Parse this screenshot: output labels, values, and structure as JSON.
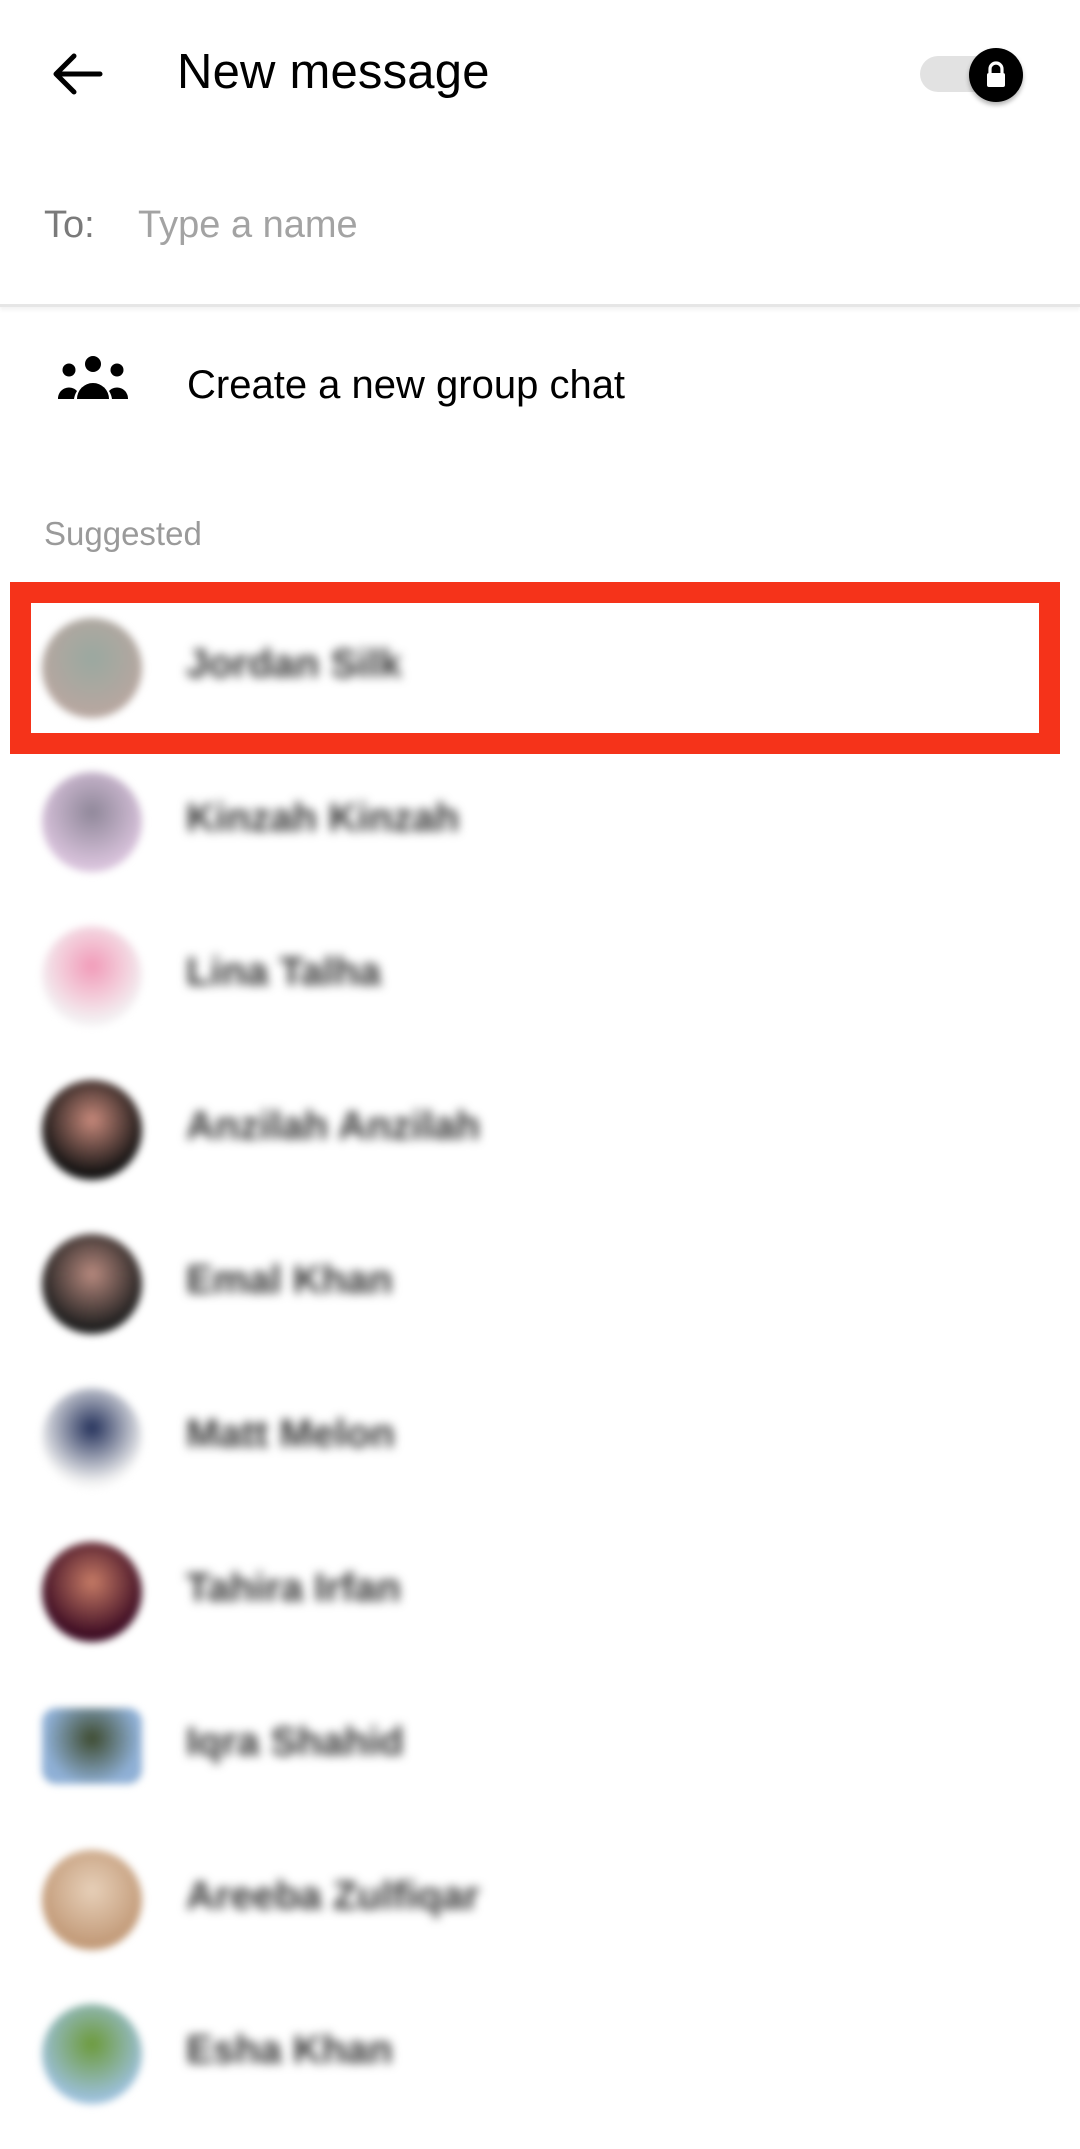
{
  "header": {
    "title": "New message",
    "back_icon": "arrow-left-icon",
    "secret_toggle": {
      "icon": "lock-icon",
      "state": "on"
    }
  },
  "to_field": {
    "label": "To:",
    "value": "",
    "placeholder": "Type a name"
  },
  "group_chat": {
    "icon": "group-icon",
    "label": "Create a new group chat"
  },
  "suggested": {
    "label": "Suggested",
    "contacts": [
      {
        "name": "Jordan Silk",
        "avatar_colors": [
          "#b7a7a0",
          "#9aa8a0"
        ],
        "highlighted": true
      },
      {
        "name": "Kinzah Kinzah",
        "avatar_colors": [
          "#d9c3dc",
          "#8f8799"
        ],
        "highlighted": false
      },
      {
        "name": "Lina Talha",
        "avatar_colors": [
          "#f3f0f2",
          "#f29ab8"
        ],
        "highlighted": false
      },
      {
        "name": "Anzilah Anzilah",
        "avatar_colors": [
          "#111111",
          "#c98a7c"
        ],
        "highlighted": false
      },
      {
        "name": "Emal Khan",
        "avatar_colors": [
          "#1e1e1e",
          "#b88a7f"
        ],
        "highlighted": false
      },
      {
        "name": "Matt Melon",
        "avatar_colors": [
          "#f4f4f4",
          "#23305a"
        ],
        "highlighted": false
      },
      {
        "name": "Tahira Irfan",
        "avatar_colors": [
          "#3b0a22",
          "#c77c66"
        ],
        "highlighted": false
      },
      {
        "name": "Iqra Shahid",
        "avatar_colors": [
          "#8fb0d6",
          "#3d4a2e"
        ],
        "highlighted": false
      },
      {
        "name": "Areeba Zulfiqar",
        "avatar_colors": [
          "#c29a78",
          "#e7d0b9"
        ],
        "highlighted": false
      },
      {
        "name": "Esha Khan",
        "avatar_colors": [
          "#9cc0da",
          "#6c9a3a"
        ],
        "highlighted": false
      }
    ]
  },
  "colors": {
    "highlight_border": "#f5331a",
    "toggle_track": "#e2e2e2",
    "toggle_knob": "#000000",
    "muted_text": "#9a9a9a"
  }
}
